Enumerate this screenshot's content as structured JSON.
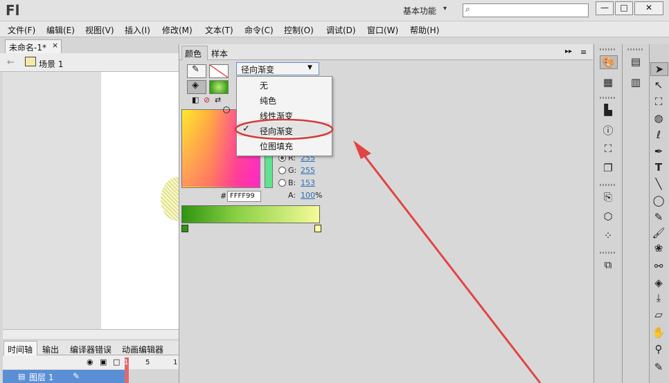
{
  "app": {
    "logo": "Fl",
    "workspace": "基本功能",
    "search_placeholder": ""
  },
  "window_buttons": {
    "minimize": "—",
    "maximize": "□",
    "close": "✕"
  },
  "menu": [
    "文件(F)",
    "编辑(E)",
    "视图(V)",
    "插入(I)",
    "修改(M)",
    "文本(T)",
    "命令(C)",
    "控制(O)",
    "调试(D)",
    "窗口(W)",
    "帮助(H)"
  ],
  "document": {
    "tab": "未命名-1*",
    "close": "×",
    "scene": "场景 1"
  },
  "timeline": {
    "tabs": [
      "时间轴",
      "输出",
      "编译器错误",
      "动画编辑器"
    ],
    "frame_numbers": [
      "1",
      "5",
      "1"
    ],
    "layer": "图层 1"
  },
  "color_panel": {
    "tabs": [
      "颜色",
      "样本"
    ],
    "type_selected": "径向渐变",
    "type_options": [
      "无",
      "纯色",
      "线性渐变",
      "径向渐变",
      "位图填充"
    ],
    "checked_option": "径向渐变",
    "rgb": {
      "r_label": "R:",
      "r": "255",
      "g_label": "G:",
      "g": "255",
      "b_label": "B:",
      "b": "153",
      "a_label": "A:",
      "a": "100",
      "a_unit": "%"
    },
    "hex_prefix": "#",
    "hex": "FFFF99",
    "gradient_colors": [
      "#2f9410",
      "#ffff99"
    ],
    "highlight_color": "#d23a3a"
  },
  "icons": {
    "back": "←",
    "collapse": "▸▸",
    "panel_menu": "≡",
    "check": "✓",
    "dropdown_arrow": "▼",
    "workspace_arrow": "▾",
    "search": "⌕"
  }
}
